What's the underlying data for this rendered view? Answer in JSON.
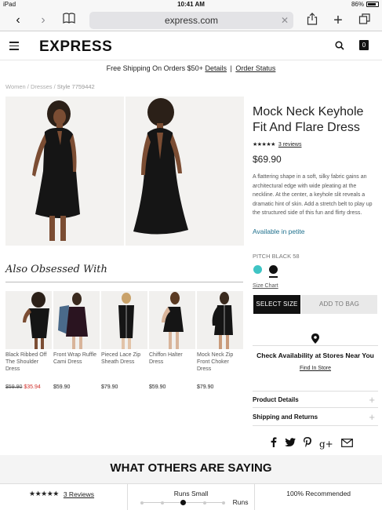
{
  "status": {
    "carrier": "iPad",
    "time": "10:41 AM",
    "battery": "86%",
    "battery_level": 0.86
  },
  "browser": {
    "url": "express.com"
  },
  "site": {
    "logo": "EXPRESS"
  },
  "promo": {
    "text": "Free Shipping On Orders $50+",
    "details": "Details",
    "order_status": "Order Status"
  },
  "breadcrumb": {
    "items": [
      "Women",
      "Dresses"
    ],
    "current": "Style 7759442"
  },
  "product": {
    "title": "Mock Neck Keyhole Fit And Flare Dress",
    "stars": "★★★★★",
    "reviews_link": "3 reviews",
    "price": "$69.90",
    "description": "A flattering shape in a soft, silky fabric gains an architectural edge with wide pleating at the neckline. At the center, a keyhole slit reveals a dramatic hint of skin. Add a stretch belt to play up the structured side of this fun and flirty dress.",
    "petite": "Available in petite",
    "color_name": "PITCH BLACK 58",
    "swatch_colors": [
      "#3fc4c4",
      "#111111"
    ],
    "size_chart": "Size Chart",
    "select_size": "SELECT SIZE",
    "add_to_bag": "ADD TO BAG",
    "check_availability": "Check Availability at Stores Near You",
    "find_in_store": "Find In Store",
    "accordion": [
      "Product Details",
      "Shipping and Returns"
    ]
  },
  "also": {
    "title": "Also Obsessed With",
    "items": [
      {
        "name": "Black Ribbed Off The Shoulder Dress",
        "old_price": "$59.90",
        "price": "$35.94"
      },
      {
        "name": "Front Wrap Ruffle Cami Dress",
        "price": "$59.90"
      },
      {
        "name": "Pieced Lace Zip Sheath Dress",
        "price": "$79.90"
      },
      {
        "name": "Chiffon Halter Dress",
        "price": "$59.90"
      },
      {
        "name": "Mock Neck Zip Front Choker Dress",
        "price": "$79.90"
      }
    ]
  },
  "reviews": {
    "heading": "WHAT OTHERS ARE SAYING",
    "stars": "★★★★★",
    "count_link": "3 Reviews",
    "fit_label": "Runs Small",
    "fit_caption": "Runs",
    "recommended": "100% Recommended"
  },
  "colors": {
    "accent_link": "#1d6f8c",
    "sale": "#d0302b"
  }
}
